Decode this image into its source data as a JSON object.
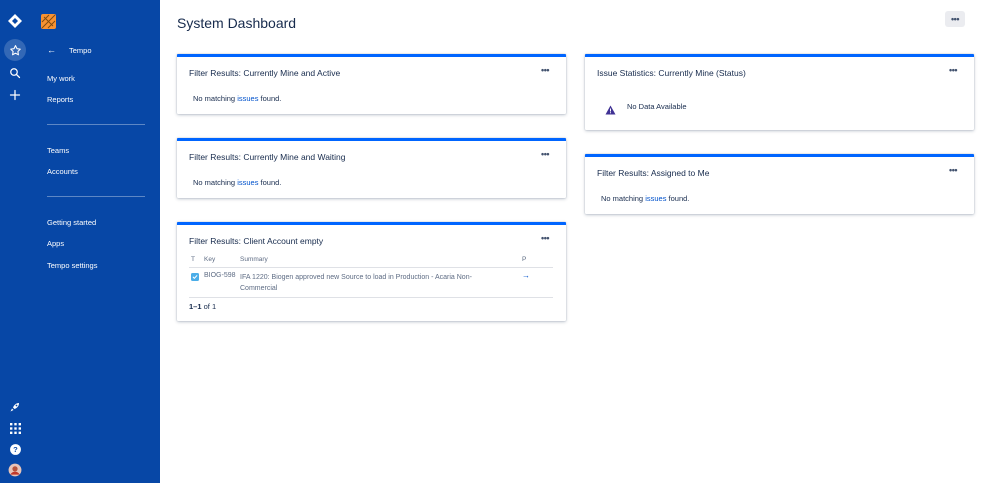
{
  "rail": {
    "icons": [
      "jira-logo-icon",
      "star-icon",
      "search-icon",
      "plus-icon",
      "rocket-icon",
      "apps-grid-icon",
      "help-icon",
      "avatar"
    ]
  },
  "sidebar": {
    "back_label": "Tempo",
    "group1": [
      {
        "label": "My work"
      },
      {
        "label": "Reports"
      }
    ],
    "group2": [
      {
        "label": "Teams"
      },
      {
        "label": "Accounts"
      }
    ],
    "group3": [
      {
        "label": "Getting started"
      },
      {
        "label": "Apps"
      },
      {
        "label": "Tempo settings"
      }
    ]
  },
  "page": {
    "title": "System Dashboard",
    "more": "•••"
  },
  "gadgets": {
    "mine_active": {
      "title": "Filter Results: Currently Mine and Active",
      "more": "•••",
      "msg_pre": "No matching ",
      "msg_link": "issues",
      "msg_post": " found."
    },
    "mine_waiting": {
      "title": "Filter Results: Currently Mine and Waiting",
      "more": "•••",
      "msg_pre": "No matching ",
      "msg_link": "issues",
      "msg_post": " found."
    },
    "client_account": {
      "title": "Filter Results: Client Account empty",
      "more": "•••",
      "columns": {
        "t": "T",
        "key": "Key",
        "summary": "Summary",
        "p": "P"
      },
      "rows": [
        {
          "key": "BIOG-598",
          "summary": "IFA 1220: Biogen approved new Source to load in Production - Acaria Non-Commercial",
          "p": "→"
        }
      ],
      "pager_range": "1–1",
      "pager_of": " of 1"
    },
    "issue_stats": {
      "title": "Issue Statistics: Currently Mine (Status)",
      "more": "•••",
      "msg": "No Data Available"
    },
    "assigned": {
      "title": "Filter Results: Assigned to Me",
      "more": "•••",
      "msg_pre": "No matching ",
      "msg_link": "issues",
      "msg_post": " found."
    }
  },
  "colors": {
    "sidebar": "#0747a6",
    "accent": "#0065ff",
    "link": "#0052cc"
  }
}
